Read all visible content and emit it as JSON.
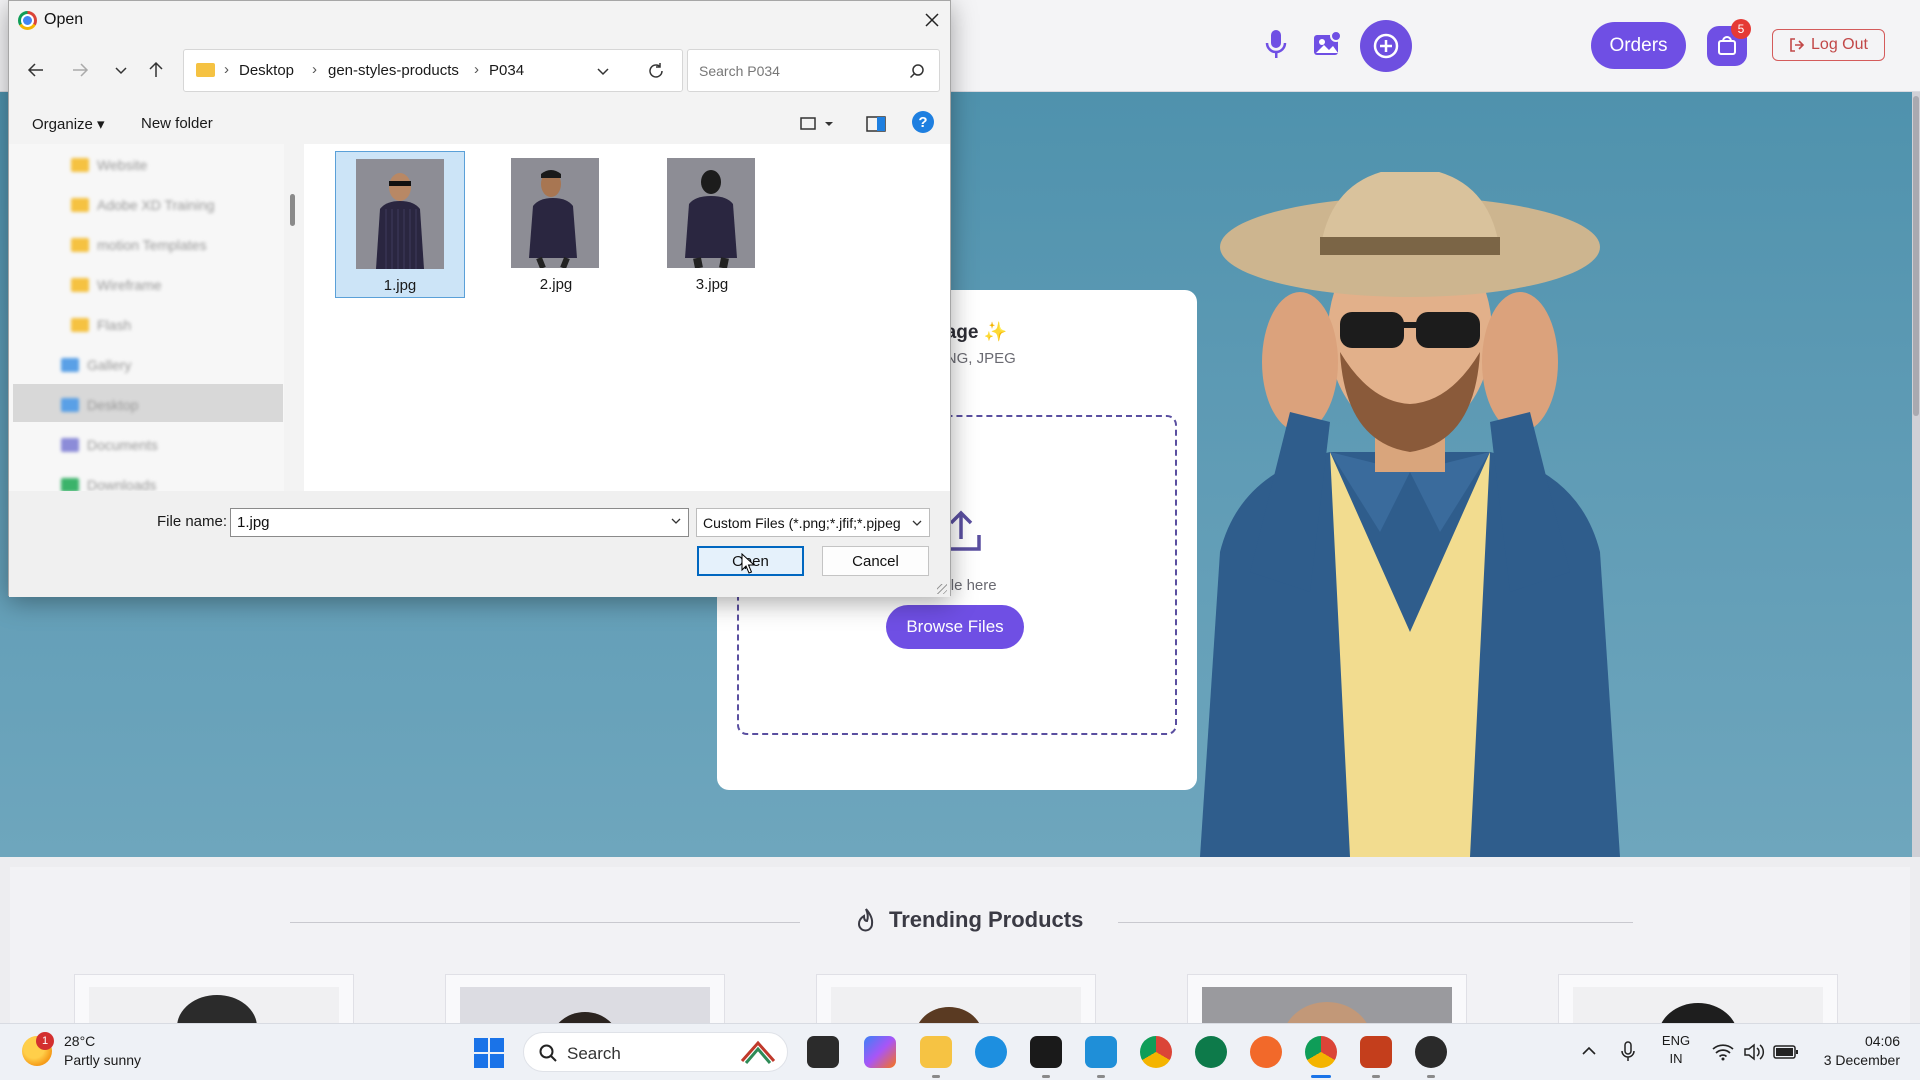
{
  "dialog": {
    "title": "Open",
    "breadcrumb": [
      "Desktop",
      "gen-styles-products",
      "P034"
    ],
    "search_placeholder": "Search P034",
    "organize_label": "Organize",
    "new_folder_label": "New folder",
    "files": [
      {
        "name": "1.jpg",
        "selected": true
      },
      {
        "name": "2.jpg",
        "selected": false
      },
      {
        "name": "3.jpg",
        "selected": false
      }
    ],
    "file_name_label": "File name:",
    "file_name_value": "1.jpg",
    "file_type_filter": "Custom Files (*.png;*.jfif;*.pjpeg",
    "open_label": "Open",
    "cancel_label": "Cancel",
    "help_glyph": "?"
  },
  "site": {
    "orders_label": "Orders",
    "cart_count": "5",
    "logout_label": "Log Out",
    "upload_title": "n Image ✨",
    "upload_subtitle": "JPG, PNG, JPEG",
    "drop_text": "our file here",
    "browse_label": "Browse Files",
    "trending_title": "Trending Products",
    "accent_color": "#6f4fe4"
  },
  "taskbar": {
    "weather_temp": "28°C",
    "weather_desc": "Partly sunny",
    "weather_badge": "1",
    "search_label": "Search",
    "language": "ENG",
    "region": "IN",
    "time": "04:06",
    "date": "3 December"
  }
}
